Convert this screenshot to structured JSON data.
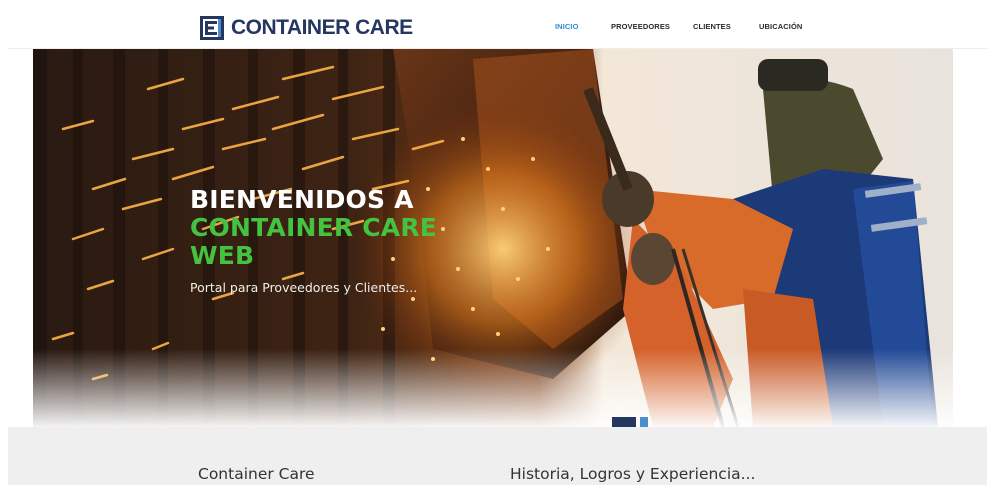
{
  "brand": {
    "name": "CONTAINER CARE",
    "color": "#253760"
  },
  "nav": {
    "items": [
      {
        "label": "INICIO",
        "active": true
      },
      {
        "label": "PROVEEDORES",
        "active": false
      },
      {
        "label": "CLIENTES",
        "active": false
      },
      {
        "label": "UBICACIÓN",
        "active": false
      }
    ],
    "active_color": "#2f8fd1"
  },
  "hero": {
    "title_line1": "BIENVENIDOS A",
    "title_line2": "CONTAINER CARE",
    "title_line3": "WEB",
    "subtitle": "Portal para Proveedores y Clientes...",
    "accent_color": "#45c23f",
    "image": "welder-grinding-sparks"
  },
  "sections": {
    "left_heading": "Container Care",
    "right_heading": "Historia, Logros y Experiencia..."
  }
}
